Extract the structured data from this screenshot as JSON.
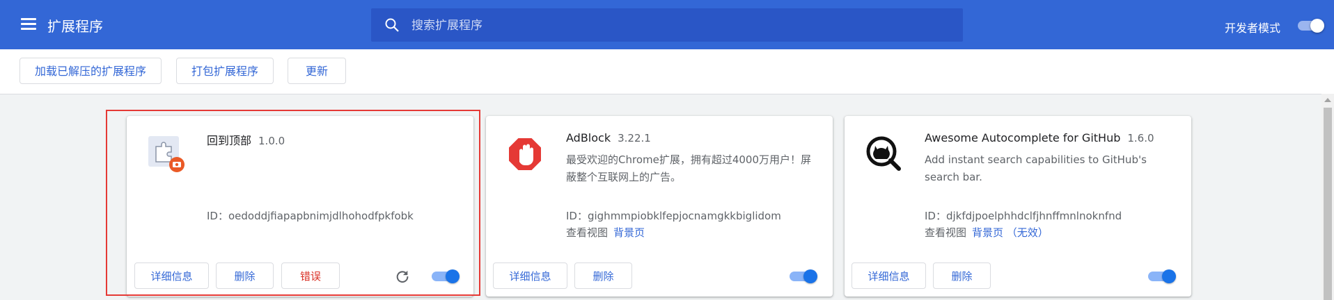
{
  "header": {
    "title": "扩展程序",
    "search_placeholder": "搜索扩展程序",
    "dev_mode_label": "开发者模式",
    "dev_mode_on": true,
    "color": "#3367d6"
  },
  "toolbar": {
    "load_unpacked": "加载已解压的扩展程序",
    "pack": "打包扩展程序",
    "update": "更新"
  },
  "extensions": [
    {
      "name": "回到顶部",
      "version": "1.0.0",
      "description": "",
      "id_text": "ID：oedoddjfiapapbnimjdlhohodfpkfobk",
      "views_label": "",
      "views_link": "",
      "details": "详细信息",
      "remove": "删除",
      "errors": "错误",
      "enabled": true,
      "icon": "puzzle-icon"
    },
    {
      "name": "AdBlock",
      "version": "3.22.1",
      "description": "最受欢迎的Chrome扩展，拥有超过4000万用户！屏蔽整个互联网上的广告。",
      "id_text": "ID：gighmmpiobklfepjocnamgkkbiglidom",
      "views_label": "查看视图",
      "views_link": "背景页",
      "details": "详细信息",
      "remove": "删除",
      "enabled": true,
      "icon": "adblock-hand-icon"
    },
    {
      "name": "Awesome Autocomplete for GitHub",
      "version": "1.6.0",
      "description": "Add instant search capabilities to GitHub's search bar.",
      "id_text": "ID：djkfdjpoelphhdclfjhnffmnlnoknfnd",
      "views_label": "查看视图",
      "views_link": "背景页 （无效）",
      "details": "详细信息",
      "remove": "删除",
      "enabled": true,
      "icon": "github-search-icon"
    }
  ]
}
